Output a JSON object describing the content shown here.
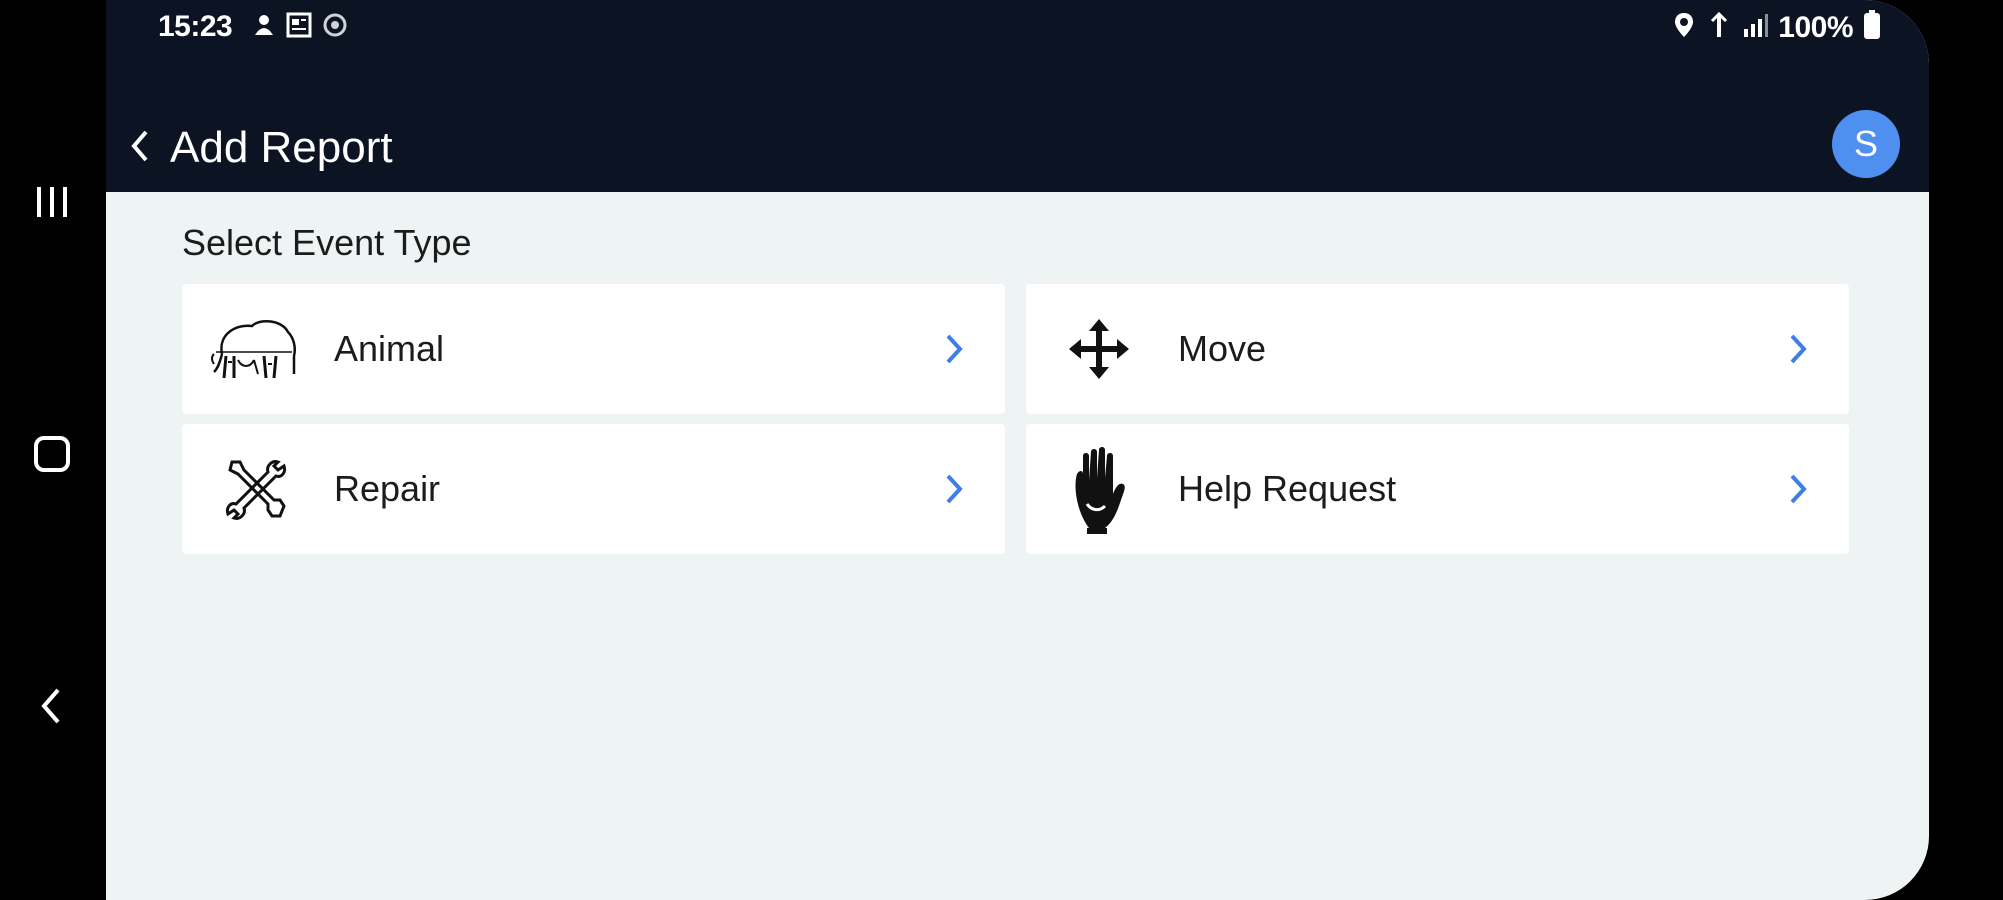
{
  "status_bar": {
    "time": "15:23",
    "battery": "100%",
    "left_icons": [
      "notification-icon",
      "news-icon",
      "sync-icon"
    ],
    "right_icons": [
      "location-icon",
      "wifi-icon",
      "signal-icon",
      "battery-icon"
    ]
  },
  "header": {
    "title": "Add Report",
    "avatar_letter": "S",
    "back_icon": "chevron-left-icon"
  },
  "main": {
    "section_title": "Select Event Type",
    "event_types": [
      {
        "label": "Animal",
        "icon": "elephant-icon"
      },
      {
        "label": "Move",
        "icon": "move-arrows-icon"
      },
      {
        "label": "Repair",
        "icon": "tools-icon"
      },
      {
        "label": "Help Request",
        "icon": "hand-icon"
      }
    ]
  },
  "system_nav": {
    "items": [
      "recent-apps-icon",
      "home-icon",
      "back-icon"
    ]
  },
  "colors": {
    "header_bg": "#0c1423",
    "page_bg": "#eef3f4",
    "accent": "#4f8ff0",
    "card_bg": "#ffffff"
  }
}
